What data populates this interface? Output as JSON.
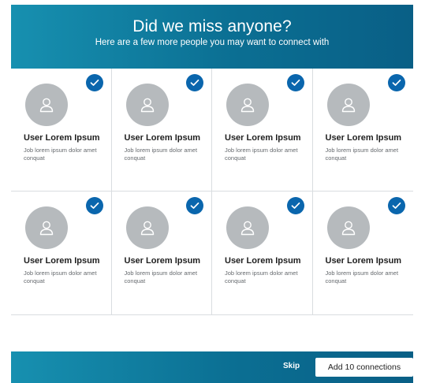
{
  "header": {
    "title": "Did we miss anyone?",
    "subtitle": "Here are a few more people you may want to connect with"
  },
  "icons": {
    "avatar": "person-silhouette-icon",
    "selected": "checkmark-icon"
  },
  "colors": {
    "header_gradient_start": "#1790b0",
    "header_gradient_end": "#095f86",
    "check_badge": "#0a66ad",
    "avatar_placeholder": "#b6babd"
  },
  "people": [
    {
      "name": "User Lorem Ipsum",
      "title": "Job lorem ipsum dolor amet conquat",
      "selected": true
    },
    {
      "name": "User Lorem Ipsum",
      "title": "Job lorem ipsum dolor amet conquat",
      "selected": true
    },
    {
      "name": "User Lorem Ipsum",
      "title": "Job lorem ipsum dolor amet conquat",
      "selected": true
    },
    {
      "name": "User Lorem Ipsum",
      "title": "Job lorem ipsum dolor amet conquat",
      "selected": true
    },
    {
      "name": "User Lorem Ipsum",
      "title": "Job lorem ipsum dolor amet conquat",
      "selected": true
    },
    {
      "name": "User Lorem Ipsum",
      "title": "Job lorem ipsum dolor amet conquat",
      "selected": true
    },
    {
      "name": "User Lorem Ipsum",
      "title": "Job lorem ipsum dolor amet conquat",
      "selected": true
    },
    {
      "name": "User Lorem Ipsum",
      "title": "Job lorem ipsum dolor amet conquat",
      "selected": true
    }
  ],
  "footer": {
    "skip_label": "Skip",
    "add_label": "Add 10 connections"
  }
}
